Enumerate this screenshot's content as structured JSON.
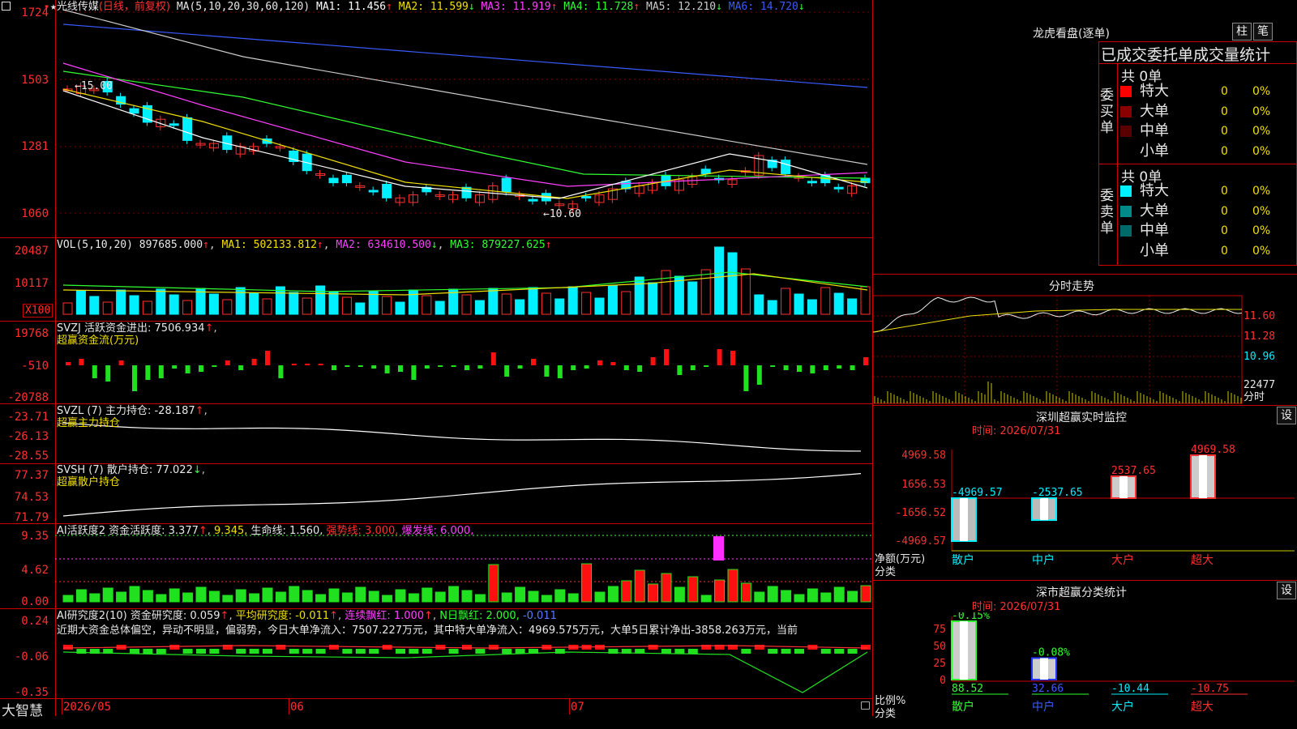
{
  "main": {
    "stock_name": "光线传媒",
    "period": "(日线，前复权)",
    "ma_params": "MA(5,10,20,30,60,120)",
    "ma": [
      {
        "label": "MA1: 11.456",
        "arrow": "↑",
        "color": "#ffffff"
      },
      {
        "label": "MA2: 11.599",
        "arrow": "↓",
        "color": "#f0e000"
      },
      {
        "label": "MA3: 11.919",
        "arrow": "↑",
        "color": "#ff40ff"
      },
      {
        "label": "MA4: 11.728",
        "arrow": "↑",
        "color": "#30ff30"
      },
      {
        "label": "MA5: 12.210",
        "arrow": "↓",
        "color": "#cccccc"
      },
      {
        "label": "MA6: 14.720",
        "arrow": "↓",
        "color": "#3a5bff"
      }
    ],
    "high_marker": "←15.00",
    "low_marker": "←10.60",
    "y_ticks": [
      "1724",
      "1503",
      "1281",
      "1060"
    ]
  },
  "volume": {
    "title": "VOL(5,10,20)",
    "value": "897685.000",
    "ma1": "MA1: 502133.812",
    "ma2": "MA2: 634610.500",
    "ma3": "MA3: 879227.625",
    "y_ticks": [
      "20487",
      "10117"
    ],
    "unit": "X100"
  },
  "svzj": {
    "title": "SVZJ  活跃资金进出: 7506.934",
    "subtitle": "超赢资金流(万元)",
    "y_ticks": [
      "19768",
      "-510",
      "-20788"
    ]
  },
  "svzl": {
    "title": "SVZL (7) 主力持仓: -28.187",
    "subtitle": "超赢主力持仓",
    "y_ticks": [
      "-23.71",
      "-26.13",
      "-28.55"
    ]
  },
  "svsh": {
    "title": "SVSH (7) 散户持仓: 77.022",
    "subtitle": "超赢散户持仓",
    "y_ticks": [
      "77.37",
      "74.53",
      "71.79"
    ]
  },
  "ai_active": {
    "title": "AI活跃度2 资金活跃度: 3.377",
    "v2": "9.345,",
    "life": "生命线: 1.560,",
    "strong": "强势线: 3.000,",
    "burst": "爆发线: 6.000,",
    "y_ticks": [
      "9.35",
      "4.62",
      "0.00"
    ]
  },
  "ai_research": {
    "title": "AI研究度2(10) 资金研究度: 0.059",
    "avg": "平均研究度: -0.011",
    "red": "连续飘红: 1.000",
    "nred": "N日飘红: 2.000,",
    "nred2": "-0.011",
    "summary": "近期大资金总体偏空，异动不明显，偏弱势，今日大单净流入：7507.227万元，其中特大单净流入：4969.575万元，大单5日累计净出-3858.263万元，当前",
    "y_ticks": [
      "0.24",
      "-0.06",
      "-0.35"
    ]
  },
  "x_axis": [
    "2026/05",
    "06",
    "07"
  ],
  "brand": "大智慧",
  "dragon": {
    "title": "龙虎看盘(逐单)",
    "btn1": "柱",
    "btn2": "笔",
    "header": "已成交委托单成交量统计",
    "buy_label": "委买单",
    "sell_label": "委卖单",
    "buy_total": "共 0单",
    "sell_total": "共 0单",
    "buy_rows": [
      {
        "name": "特大",
        "count": "0",
        "pct": "0%",
        "color": "#ff0000"
      },
      {
        "name": "大单",
        "count": "0",
        "pct": "0%",
        "color": "#8a0000"
      },
      {
        "name": "中单",
        "count": "0",
        "pct": "0%",
        "color": "#5a0000"
      },
      {
        "name": "小单",
        "count": "0",
        "pct": "0%",
        "color": "#000000"
      }
    ],
    "sell_rows": [
      {
        "name": "特大",
        "count": "0",
        "pct": "0%",
        "color": "#00f0ff"
      },
      {
        "name": "大单",
        "count": "0",
        "pct": "0%",
        "color": "#008a8a"
      },
      {
        "name": "中单",
        "count": "0",
        "pct": "0%",
        "color": "#006a6a"
      },
      {
        "name": "小单",
        "count": "0",
        "pct": "0%",
        "color": "#000000"
      }
    ]
  },
  "intraday": {
    "title": "分时走势",
    "y_ticks": [
      "11.60",
      "11.28",
      "10.96"
    ],
    "vol_tick": "22477",
    "vol_unit": "分时"
  },
  "sz_monitor": {
    "title": "深圳超赢实时监控",
    "btn": "设",
    "time": "时间: 2026/07/31",
    "y_ticks": [
      "4969.58",
      "1656.53",
      "-1656.52",
      "-4969.57"
    ],
    "ylabel": "净额(万元)",
    "xlabel": "分类",
    "bars": [
      {
        "cat": "散户",
        "label": "-4969.57",
        "value": -4969.57
      },
      {
        "cat": "中户",
        "label": "-2537.65",
        "value": -2537.65
      },
      {
        "cat": "大户",
        "label": "2537.65",
        "value": 2537.65
      },
      {
        "cat": "超大",
        "label": "4969.58",
        "value": 4969.58
      }
    ]
  },
  "sz_class": {
    "title": "深市超赢分类统计",
    "btn": "设",
    "time": "时间: 2026/07/31",
    "y_ticks": [
      "75",
      "50",
      "25",
      "0"
    ],
    "ylabel": "比例%",
    "xlabel": "分类",
    "bars": [
      {
        "cat": "散户",
        "top": "-0.15%",
        "bottom": "88.52",
        "value": 88.52
      },
      {
        "cat": "中户",
        "top": "-0.08%",
        "bottom": "32.66",
        "value": 32.66
      },
      {
        "cat": "大户",
        "top": "",
        "bottom": "-10.44",
        "value": 0
      },
      {
        "cat": "超大",
        "top": "",
        "bottom": "-10.75",
        "value": 0
      }
    ]
  }
}
